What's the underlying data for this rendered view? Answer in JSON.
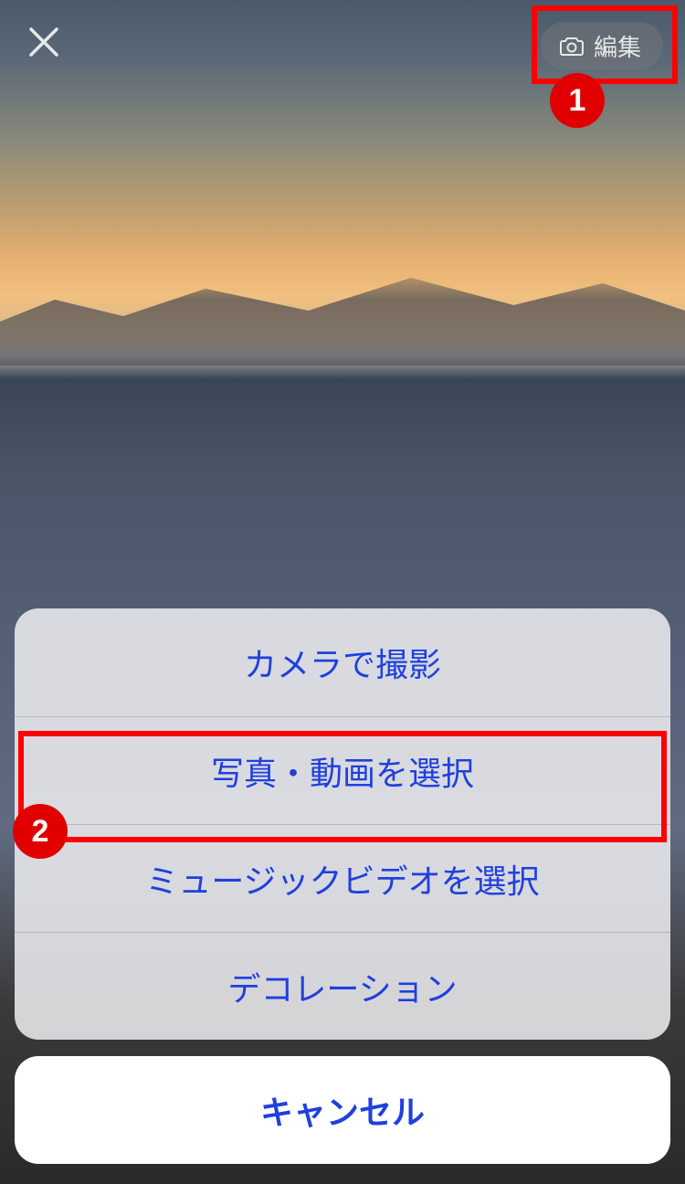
{
  "header": {
    "edit_label": "編集"
  },
  "annotations": {
    "badge1": "1",
    "badge2": "2"
  },
  "action_sheet": {
    "items": [
      {
        "label": "カメラで撮影"
      },
      {
        "label": "写真・動画を選択"
      },
      {
        "label": "ミュージックビデオを選択"
      },
      {
        "label": "デコレーション"
      }
    ],
    "cancel_label": "キャンセル"
  }
}
